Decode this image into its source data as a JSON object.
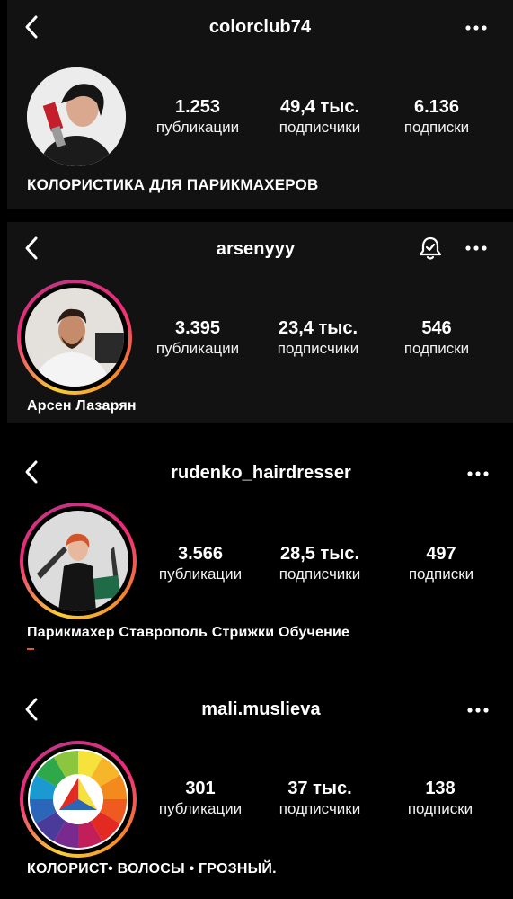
{
  "profiles": [
    {
      "username": "colorclub74",
      "stats": {
        "posts": "1.253",
        "followers": "49,4 тыс.",
        "following": "6.136"
      },
      "labels": {
        "posts": "публикации",
        "followers": "подписчики",
        "following": "подписки"
      },
      "bio": "КОЛОРИСТИКА ДЛЯ ПАРИКМАХЕРОВ"
    },
    {
      "username": "arsenyyy",
      "stats": {
        "posts": "3.395",
        "followers": "23,4 тыс.",
        "following": "546"
      },
      "labels": {
        "posts": "публикации",
        "followers": "подписчики",
        "following": "подписки"
      },
      "bio": "Арсен Лазарян"
    },
    {
      "username": "rudenko_hairdresser",
      "stats": {
        "posts": "3.566",
        "followers": "28,5 тыс.",
        "following": "497"
      },
      "labels": {
        "posts": "публикации",
        "followers": "подписчики",
        "following": "подписки"
      },
      "bio": "Парикмахер Ставрополь Стрижки Обучение"
    },
    {
      "username": "mali.muslieva",
      "stats": {
        "posts": "301",
        "followers": "37 тыс.",
        "following": "138"
      },
      "labels": {
        "posts": "публикации",
        "followers": "подписчики",
        "following": "подписки"
      },
      "bio": "КОЛОРИСТ• ВОЛОСЫ • ГРОЗНЫЙ."
    }
  ],
  "icons": {
    "back": "chevron-left-icon",
    "more": "more-horizontal-icon",
    "notifications": "bell-check-icon"
  },
  "colors": {
    "background": "#000000",
    "card": "#121212",
    "text": "#ffffff",
    "story_ring_start": "#f9ce34",
    "story_ring_end": "#ee2a7b"
  }
}
